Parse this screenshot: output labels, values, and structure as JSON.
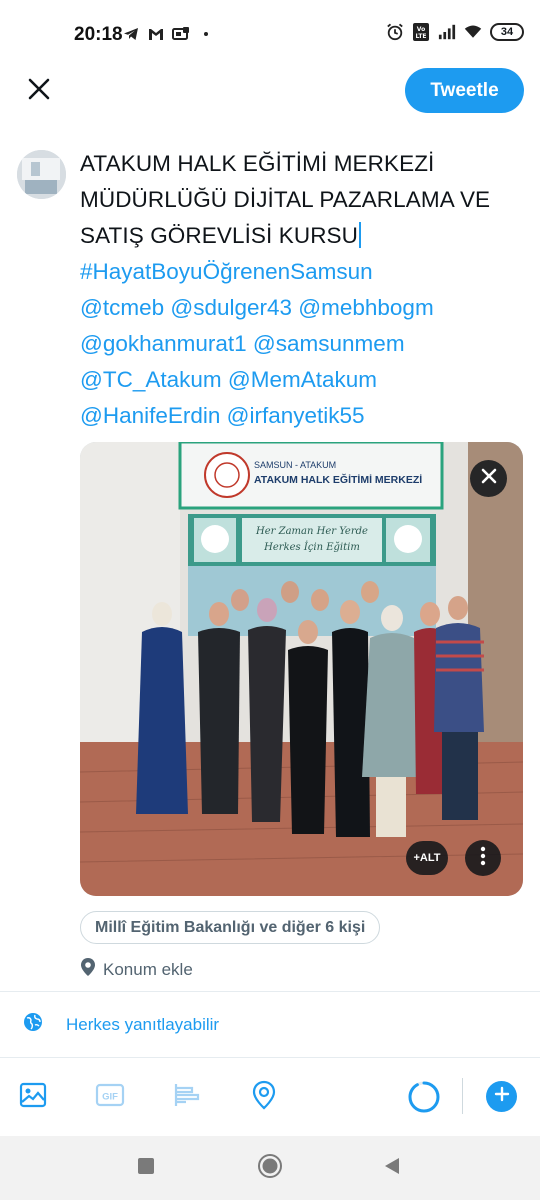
{
  "status_bar": {
    "time": "20:18",
    "left_icons": [
      "telegram-icon",
      "gmail-icon",
      "notification-icon",
      "dot-icon"
    ],
    "right_icons": [
      "alarm-icon",
      "volte-icon",
      "signal-icon",
      "wifi-icon"
    ],
    "battery_level": "34"
  },
  "header": {
    "close_icon": "close-icon",
    "tweet_label": "Tweetle"
  },
  "composer": {
    "line1": "ATAKUM HALK EĞİTİMİ MERKEZİ",
    "line2": "MÜDÜRLÜĞÜ DİJİTAL PAZARLAMA VE",
    "line3": "SATIŞ GÖREVLİSİ KURSU",
    "hashtag": "#HayatBoyuÖğrenenSamsun",
    "mentions1": "@tcmeb @sdulger43 @mebhbogm",
    "mentions2": "@gokhanmurat1 @samsunmem",
    "mentions3": "@TC_Atakum @MemAtakum",
    "mentions4": "@HanifeErdin @irfanyetik55"
  },
  "photo": {
    "sign_small": "SAMSUN - ATAKUM",
    "sign_big": "ATAKUM HALK EĞİTİMİ MERKEZİ",
    "banner_line1": "Her Zaman Her Yerde",
    "banner_line2": "Herkes İçin Eğitim",
    "alt_label": "+ALT"
  },
  "tags": {
    "label": "Millî Eğitim Bakanlığı ve diğer 6 kişi"
  },
  "location": {
    "label": "Konum ekle"
  },
  "reply": {
    "label": "Herkes yanıtlayabilir"
  },
  "toolbar": {
    "icons": [
      "image-icon",
      "gif-icon",
      "poll-icon",
      "location-icon"
    ],
    "gif_text": "GIF",
    "char_progress": 0.92
  },
  "colors": {
    "accent": "#1d9bf0",
    "text": "#0f1419",
    "secondary": "#536471"
  }
}
